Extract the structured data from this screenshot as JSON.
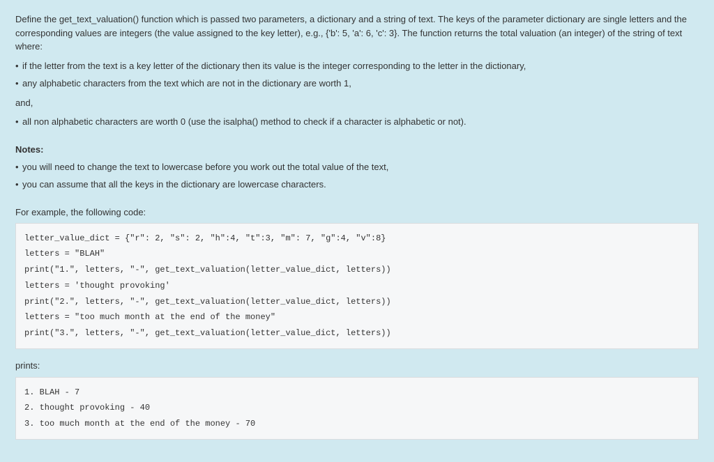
{
  "intro": {
    "p1": "Define the get_text_valuation() function which is passed two parameters, a dictionary and a string of text.  The keys of the parameter dictionary are single letters and the corresponding values are integers (the value assigned to the key letter), e.g., {'b': 5, 'a': 6, 'c': 3}.  The function returns the total valuation (an integer) of the string of text where:"
  },
  "ruleBullets": [
    "if the letter from the text is a key letter of the dictionary then its value is the integer corresponding to the letter in the dictionary,",
    "any alphabetic characters from the text which are not in the dictionary are worth 1,"
  ],
  "andText": "and,",
  "ruleBullets2": [
    "all non alphabetic characters are worth 0 (use the isalpha() method to check if a character is alphabetic or not)."
  ],
  "notesHeading": "Notes:",
  "notesBullets": [
    "you will need to change the text to lowercase before you work out the total value of the text,",
    "you can assume that all the keys in the dictionary are lowercase characters."
  ],
  "exampleLabel": "For example, the following code:",
  "codeBlock1": "letter_value_dict = {\"r\": 2, \"s\": 2, \"h\":4, \"t\":3, \"m\": 7, \"g\":4, \"v\":8}\nletters = \"BLAH\"\nprint(\"1.\", letters, \"-\", get_text_valuation(letter_value_dict, letters))\nletters = 'thought provoking'\nprint(\"2.\", letters, \"-\", get_text_valuation(letter_value_dict, letters))\nletters = \"too much month at the end of the money\"\nprint(\"3.\", letters, \"-\", get_text_valuation(letter_value_dict, letters))",
  "printsLabel": "prints:",
  "codeBlock2": "1. BLAH - 7\n2. thought provoking - 40\n3. too much month at the end of the money - 70"
}
